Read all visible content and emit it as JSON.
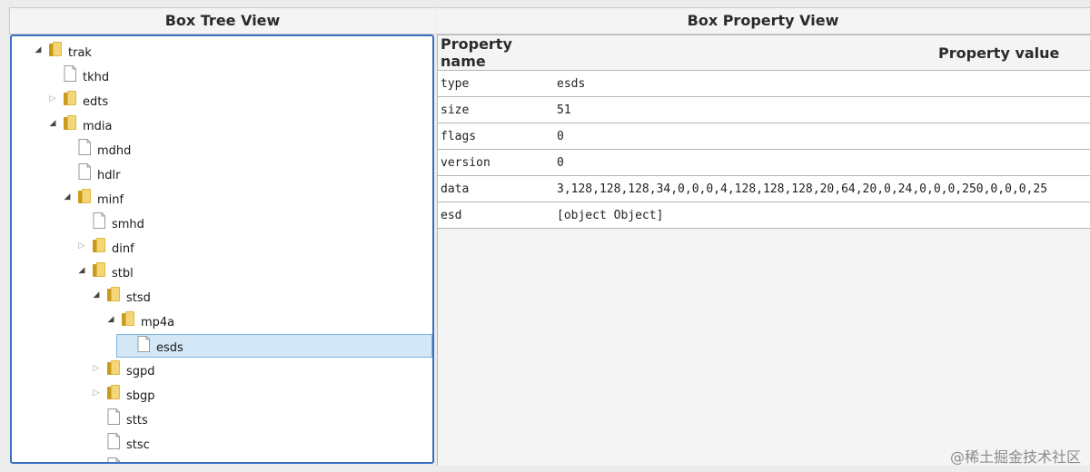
{
  "left_panel": {
    "title": "Box Tree View"
  },
  "right_panel": {
    "title": "Box Property View"
  },
  "tree": {
    "nodes": [
      {
        "label": "trak",
        "depth": 0,
        "type": "folder",
        "state": "expanded"
      },
      {
        "label": "tkhd",
        "depth": 1,
        "type": "file"
      },
      {
        "label": "edts",
        "depth": 1,
        "type": "folder",
        "state": "collapsed"
      },
      {
        "label": "mdia",
        "depth": 1,
        "type": "folder",
        "state": "expanded"
      },
      {
        "label": "mdhd",
        "depth": 2,
        "type": "file"
      },
      {
        "label": "hdlr",
        "depth": 2,
        "type": "file"
      },
      {
        "label": "minf",
        "depth": 2,
        "type": "folder",
        "state": "expanded"
      },
      {
        "label": "smhd",
        "depth": 3,
        "type": "file"
      },
      {
        "label": "dinf",
        "depth": 3,
        "type": "folder",
        "state": "collapsed"
      },
      {
        "label": "stbl",
        "depth": 3,
        "type": "folder",
        "state": "expanded"
      },
      {
        "label": "stsd",
        "depth": 4,
        "type": "folder",
        "state": "expanded"
      },
      {
        "label": "mp4a",
        "depth": 5,
        "type": "folder",
        "state": "expanded"
      },
      {
        "label": "esds",
        "depth": 6,
        "type": "file",
        "selected": true
      },
      {
        "label": "sgpd",
        "depth": 4,
        "type": "folder",
        "state": "collapsed"
      },
      {
        "label": "sbgp",
        "depth": 4,
        "type": "folder",
        "state": "collapsed"
      },
      {
        "label": "stts",
        "depth": 4,
        "type": "file"
      },
      {
        "label": "stsc",
        "depth": 4,
        "type": "file"
      },
      {
        "label": "",
        "depth": 4,
        "type": "file"
      }
    ]
  },
  "properties": {
    "headers": {
      "name": "Property name",
      "value": "Property value"
    },
    "rows": [
      {
        "name": "type",
        "value": "esds"
      },
      {
        "name": "size",
        "value": "51"
      },
      {
        "name": "flags",
        "value": "0"
      },
      {
        "name": "version",
        "value": "0"
      },
      {
        "name": "data",
        "value": "3,128,128,128,34,0,0,0,4,128,128,128,20,64,20,0,24,0,0,0,250,0,0,0,25"
      },
      {
        "name": "esd",
        "value": "[object Object]"
      }
    ]
  },
  "watermark": "@稀土掘金技术社区",
  "colors": {
    "selection": "#d3e7f7",
    "focus_border": "#3b6fc0",
    "folder": "#e0b83a"
  }
}
